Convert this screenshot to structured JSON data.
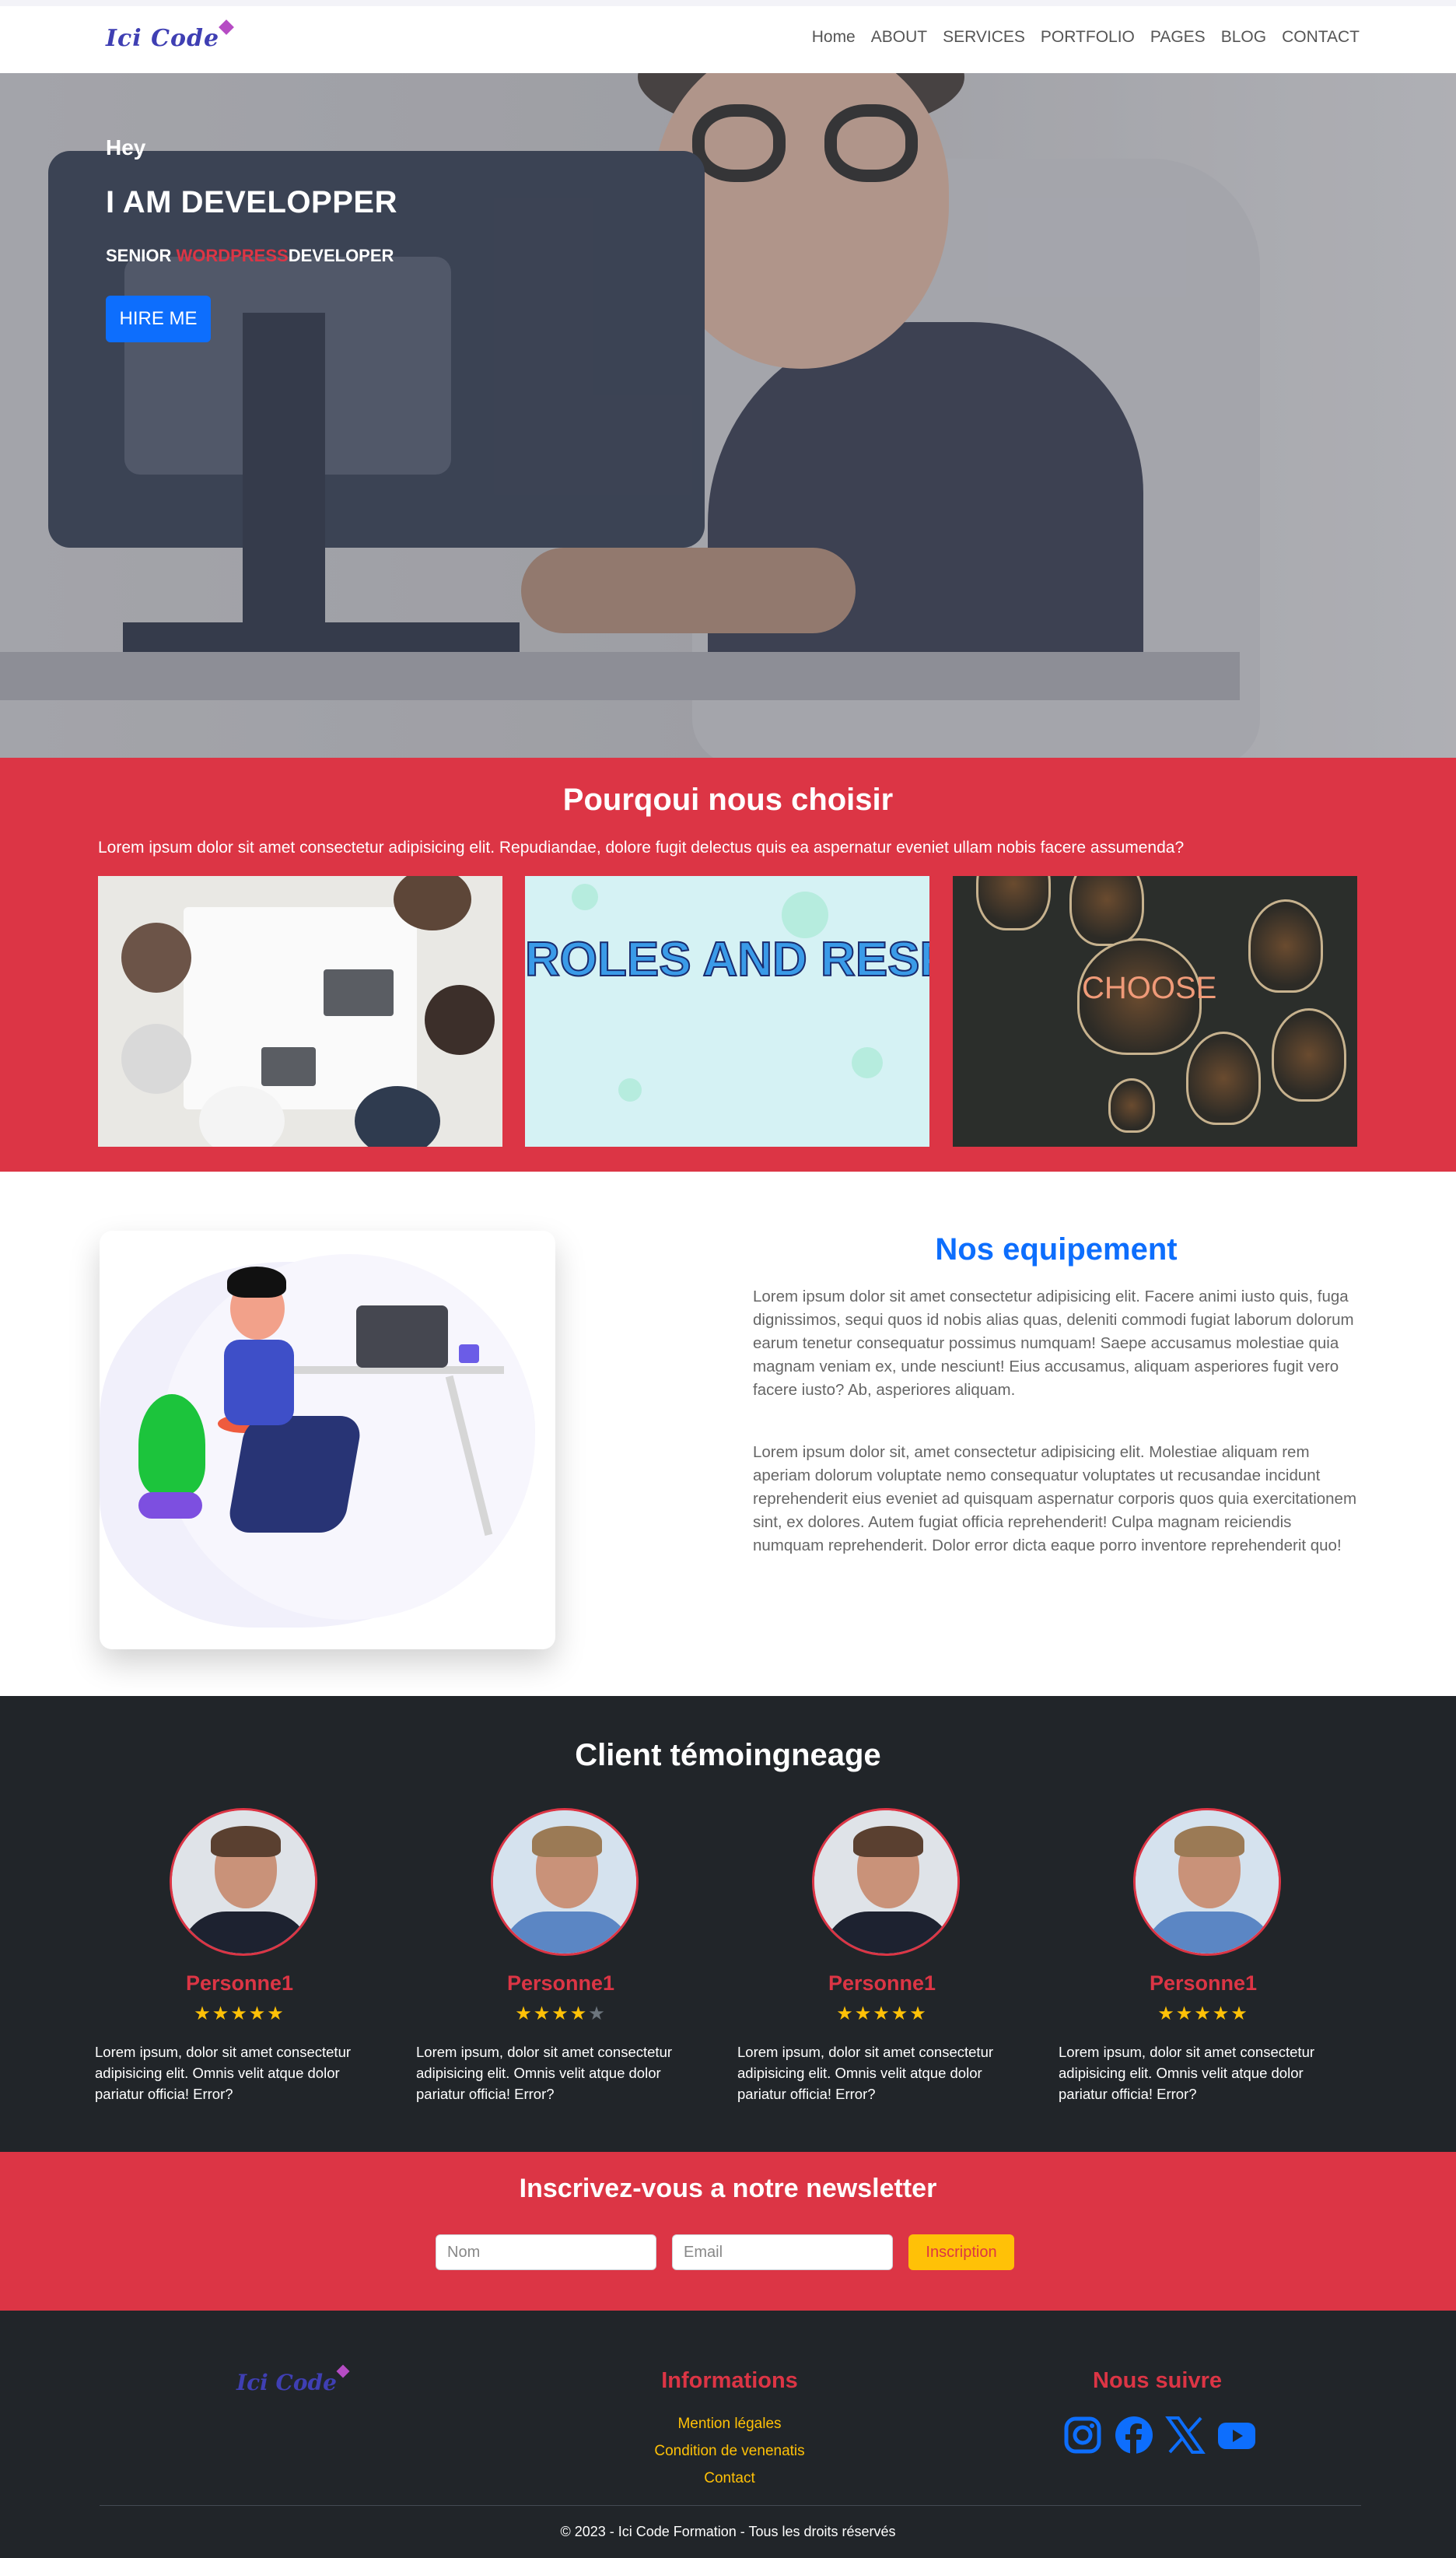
{
  "brand": {
    "logo_text": "Ici Code"
  },
  "nav": {
    "items": [
      "Home",
      "ABOUT",
      "SERVICES",
      "PORTFOLIO",
      "PAGES",
      "BLOG",
      "CONTACT"
    ]
  },
  "hero": {
    "greeting": "Hey",
    "title": "I AM DEVELOPPER",
    "sub_prefix": "SENIOR ",
    "sub_highlight": "WORDPRESS",
    "sub_suffix": "DEVELOPER",
    "cta_label": "HIRE ME"
  },
  "why": {
    "title": "Pourqoui nous choisir",
    "text": "Lorem ipsum dolor sit amet consectetur adipisicing elit. Repudiandae, dolore fugit delectus quis ea aspernatur eveniet ullam nobis facere assumenda?",
    "image2_text": "ROLES AND RESPONSIBILITIES",
    "image3_text": "CHOOSE"
  },
  "equipment": {
    "title": "Nos equipement",
    "paragraph1": "Lorem ipsum dolor sit amet consectetur adipisicing elit. Facere animi iusto quis, fuga dignissimos, sequi quos id nobis alias quas, deleniti commodi fugiat laborum dolorum earum tenetur consequatur possimus numquam! Saepe accusamus molestiae quia magnam veniam ex, unde nesciunt! Eius accusamus, aliquam asperiores fugit vero facere iusto? Ab, asperiores aliquam.",
    "paragraph2": "Lorem ipsum dolor sit, amet consectetur adipisicing elit. Molestiae aliquam rem aperiam dolorum voluptate nemo consequatur voluptates ut recusandae incidunt reprehenderit eius eveniet ad quisquam aspernatur corporis quos quia exercitationem sint, ex dolores. Autem fugiat officia reprehenderit! Culpa magnam reiciendis numquam reprehenderit. Dolor error dicta eaque porro inventore reprehenderit quo!"
  },
  "testimonials": {
    "title": "Client témoingneage",
    "items": [
      {
        "name": "Personne1",
        "rating": 5,
        "text": "Lorem ipsum, dolor sit amet consectetur adipisicing elit. Omnis velit atque dolor pariatur officia! Error?"
      },
      {
        "name": "Personne1",
        "rating": 4,
        "text": "Lorem ipsum, dolor sit amet consectetur adipisicing elit. Omnis velit atque dolor pariatur officia! Error?"
      },
      {
        "name": "Personne1",
        "rating": 5,
        "text": "Lorem ipsum, dolor sit amet consectetur adipisicing elit. Omnis velit atque dolor pariatur officia! Error?"
      },
      {
        "name": "Personne1",
        "rating": 5,
        "text": "Lorem ipsum, dolor sit amet consectetur adipisicing elit. Omnis velit atque dolor pariatur officia! Error?"
      }
    ]
  },
  "newsletter": {
    "title": "Inscrivez-vous a notre newsletter",
    "name_placeholder": "Nom",
    "email_placeholder": "Email",
    "button_label": "Inscription"
  },
  "footer": {
    "logo_text": "Ici Code",
    "info_title": "Informations",
    "links": [
      "Mention légales",
      "Condition de venenatis",
      "Contact"
    ],
    "follow_title": "Nous suivre",
    "social_icons": [
      "instagram-icon",
      "facebook-icon",
      "x-icon",
      "youtube-icon"
    ],
    "copyright": "© 2023 - Ici Code Formation - Tous les droits réservés"
  },
  "colors": {
    "primary": "#0d6efd",
    "danger": "#dc3545",
    "warning": "#ffc107",
    "dark": "#212529"
  }
}
